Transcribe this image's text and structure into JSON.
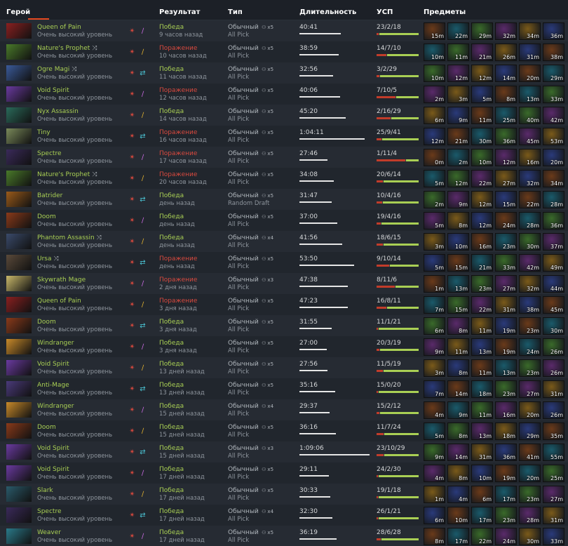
{
  "headers": {
    "hero": "Герой",
    "result": "Результат",
    "type": "Тип",
    "duration": "Длительность",
    "kda": "УСП",
    "items": "Предметы"
  },
  "rows": [
    {
      "hero": "Queen of Pain",
      "skill": "Очень высокий уровень",
      "result": "Победа",
      "win": true,
      "ago": "9 часов назад",
      "type": "Обычный",
      "party": "x5",
      "mode": "All Pick",
      "duration": "40:41",
      "kda": "23/2/18",
      "k": 23,
      "d": 2,
      "a": 18,
      "items": [
        "15m",
        "22m",
        "29m",
        "32m",
        "34m",
        "36m"
      ],
      "portrait": "#8a2020"
    },
    {
      "hero": "Nature's Prophet",
      "shuffle": true,
      "skill": "Очень высокий уровень",
      "result": "Поражение",
      "win": false,
      "ago": "10 часов назад",
      "type": "Обычный",
      "party": "x5",
      "mode": "All Pick",
      "duration": "38:59",
      "kda": "14/7/10",
      "k": 14,
      "d": 7,
      "a": 10,
      "items": [
        "10m",
        "11m",
        "21m",
        "26m",
        "31m",
        "38m"
      ],
      "portrait": "#4a7a2a"
    },
    {
      "hero": "Ogre Magi",
      "shuffle": true,
      "skill": "Очень высокий уровень",
      "result": "Победа",
      "win": true,
      "ago": "11 часов назад",
      "type": "Обычный",
      "party": "x5",
      "mode": "All Pick",
      "duration": "32:56",
      "kda": "3/2/29",
      "k": 3,
      "d": 2,
      "a": 29,
      "items": [
        "10m",
        "12m",
        "12m",
        "14m",
        "20m",
        "29m"
      ],
      "portrait": "#3a5a9a"
    },
    {
      "hero": "Void Spirit",
      "skill": "Очень высокий уровень",
      "result": "Поражение",
      "win": false,
      "ago": "12 часов назад",
      "type": "Обычный",
      "party": "x5",
      "mode": "All Pick",
      "duration": "40:06",
      "kda": "7/10/5",
      "k": 7,
      "d": 10,
      "a": 5,
      "items": [
        "2m",
        "3m",
        "5m",
        "8m",
        "13m",
        "33m"
      ],
      "portrait": "#6a3aa0"
    },
    {
      "hero": "Nyx Assassin",
      "skill": "Очень высокий уровень",
      "result": "Победа",
      "win": true,
      "ago": "14 часов назад",
      "type": "Обычный",
      "party": "x5",
      "mode": "All Pick",
      "duration": "45:20",
      "kda": "2/16/29",
      "k": 2,
      "d": 16,
      "a": 29,
      "items": [
        "6m",
        "9m",
        "11m",
        "25m",
        "40m",
        "42m"
      ],
      "portrait": "#2a6a5a"
    },
    {
      "hero": "Tiny",
      "skill": "Очень высокий уровень",
      "result": "Поражение",
      "win": false,
      "ago": "16 часов назад",
      "type": "Обычный",
      "party": "x5",
      "mode": "All Pick",
      "duration": "1:04:11",
      "kda": "25/9/41",
      "k": 25,
      "d": 9,
      "a": 41,
      "items": [
        "12m",
        "21m",
        "30m",
        "36m",
        "45m",
        "53m"
      ],
      "portrait": "#7a8a5a"
    },
    {
      "hero": "Spectre",
      "skill": "Очень высокий уровень",
      "result": "Поражение",
      "win": false,
      "ago": "17 часов назад",
      "type": "Обычный",
      "party": "x5",
      "mode": "All Pick",
      "duration": "27:46",
      "kda": "1/11/4",
      "k": 1,
      "d": 11,
      "a": 4,
      "items": [
        "0m",
        "2m",
        "10m",
        "12m",
        "16m",
        "20m"
      ],
      "portrait": "#3a2a5a"
    },
    {
      "hero": "Nature's Prophet",
      "shuffle": true,
      "skill": "Очень высокий уровень",
      "result": "Поражение",
      "win": false,
      "ago": "20 часов назад",
      "type": "Обычный",
      "party": "x5",
      "mode": "All Pick",
      "duration": "34:08",
      "kda": "20/6/14",
      "k": 20,
      "d": 6,
      "a": 14,
      "items": [
        "5m",
        "12m",
        "22m",
        "27m",
        "32m",
        "34m"
      ],
      "portrait": "#4a7a2a"
    },
    {
      "hero": "Batrider",
      "skill": "Очень высокий уровень",
      "result": "Победа",
      "win": true,
      "ago": "день назад",
      "type": "Обычный",
      "party": "x5",
      "mode": "Random Draft",
      "duration": "31:47",
      "kda": "10/4/16",
      "k": 10,
      "d": 4,
      "a": 16,
      "items": [
        "2m",
        "9m",
        "12m",
        "15m",
        "22m",
        "28m"
      ],
      "portrait": "#9a5a1a"
    },
    {
      "hero": "Doom",
      "skill": "Очень высокий уровень",
      "result": "Победа",
      "win": true,
      "ago": "день назад",
      "type": "Обычный",
      "party": "x5",
      "mode": "All Pick",
      "duration": "37:00",
      "kda": "19/4/16",
      "k": 19,
      "d": 4,
      "a": 16,
      "items": [
        "5m",
        "8m",
        "12m",
        "24m",
        "28m",
        "36m"
      ],
      "portrait": "#8a3a1a"
    },
    {
      "hero": "Phantom Assassin",
      "shuffle": true,
      "skill": "Очень высокий уровень",
      "result": "Победа",
      "win": true,
      "ago": "день назад",
      "type": "Обычный",
      "party": "x4",
      "mode": "All Pick",
      "duration": "41:56",
      "kda": "18/6/15",
      "k": 18,
      "d": 6,
      "a": 15,
      "items": [
        "3m",
        "10m",
        "16m",
        "23m",
        "30m",
        "37m"
      ],
      "portrait": "#3a4a6a"
    },
    {
      "hero": "Ursa",
      "shuffle": true,
      "skill": "Очень высокий уровень",
      "result": "Поражение",
      "win": false,
      "ago": "день назад",
      "type": "Обычный",
      "party": "x5",
      "mode": "All Pick",
      "duration": "53:50",
      "kda": "9/10/14",
      "k": 9,
      "d": 10,
      "a": 14,
      "items": [
        "5m",
        "15m",
        "21m",
        "33m",
        "42m",
        "49m"
      ],
      "portrait": "#5a4a3a"
    },
    {
      "hero": "Skywrath Mage",
      "skill": "Очень высокий уровень",
      "result": "Поражение",
      "win": false,
      "ago": "2 дня назад",
      "type": "Обычный",
      "party": "x3",
      "mode": "All Pick",
      "duration": "47:38",
      "kda": "8/11/6",
      "k": 8,
      "d": 11,
      "a": 6,
      "items": [
        "1m",
        "13m",
        "23m",
        "27m",
        "32m",
        "44m"
      ],
      "portrait": "#c8b86a"
    },
    {
      "hero": "Queen of Pain",
      "skill": "Очень высокий уровень",
      "result": "Поражение",
      "win": false,
      "ago": "3 дня назад",
      "type": "Обычный",
      "party": "x5",
      "mode": "All Pick",
      "duration": "47:23",
      "kda": "16/8/11",
      "k": 16,
      "d": 8,
      "a": 11,
      "items": [
        "7m",
        "15m",
        "22m",
        "31m",
        "38m",
        "45m"
      ],
      "portrait": "#8a2020"
    },
    {
      "hero": "Doom",
      "skill": "Очень высокий уровень",
      "result": "Победа",
      "win": true,
      "ago": "3 дня назад",
      "type": "Обычный",
      "party": "x5",
      "mode": "All Pick",
      "duration": "31:55",
      "kda": "11/1/21",
      "k": 11,
      "d": 1,
      "a": 21,
      "items": [
        "6m",
        "8m",
        "11m",
        "19m",
        "23m",
        "30m"
      ],
      "portrait": "#8a3a1a"
    },
    {
      "hero": "Windranger",
      "skill": "Очень высокий уровень",
      "result": "Победа",
      "win": true,
      "ago": "3 дня назад",
      "type": "Обычный",
      "party": "x5",
      "mode": "All Pick",
      "duration": "27:00",
      "kda": "20/3/19",
      "k": 20,
      "d": 3,
      "a": 19,
      "items": [
        "9m",
        "11m",
        "13m",
        "19m",
        "24m",
        "26m"
      ],
      "portrait": "#c88a2a"
    },
    {
      "hero": "Void Spirit",
      "skill": "Очень высокий уровень",
      "result": "Победа",
      "win": true,
      "ago": "13 дней назад",
      "type": "Обычный",
      "party": "x5",
      "mode": "All Pick",
      "duration": "27:56",
      "kda": "11/5/19",
      "k": 11,
      "d": 5,
      "a": 19,
      "items": [
        "3m",
        "8m",
        "11m",
        "13m",
        "23m",
        "26m"
      ],
      "portrait": "#6a3aa0"
    },
    {
      "hero": "Anti-Mage",
      "skill": "Очень высокий уровень",
      "result": "Победа",
      "win": true,
      "ago": "13 дней назад",
      "type": "Обычный",
      "party": "x5",
      "mode": "All Pick",
      "duration": "35:16",
      "kda": "15/0/20",
      "k": 15,
      "d": 0,
      "a": 20,
      "items": [
        "7m",
        "14m",
        "18m",
        "23m",
        "27m",
        "31m"
      ],
      "portrait": "#4a3a7a"
    },
    {
      "hero": "Windranger",
      "skill": "Очень высокий уровень",
      "result": "Победа",
      "win": true,
      "ago": "15 дней назад",
      "type": "Обычный",
      "party": "x4",
      "mode": "All Pick",
      "duration": "29:37",
      "kda": "15/2/12",
      "k": 15,
      "d": 2,
      "a": 12,
      "items": [
        "4m",
        "9m",
        "11m",
        "16m",
        "20m",
        "26m"
      ],
      "portrait": "#c88a2a"
    },
    {
      "hero": "Doom",
      "skill": "Очень высокий уровень",
      "result": "Победа",
      "win": true,
      "ago": "15 дней назад",
      "type": "Обычный",
      "party": "x5",
      "mode": "All Pick",
      "duration": "36:16",
      "kda": "11/7/24",
      "k": 11,
      "d": 7,
      "a": 24,
      "items": [
        "5m",
        "8m",
        "13m",
        "18m",
        "29m",
        "35m"
      ],
      "portrait": "#8a3a1a"
    },
    {
      "hero": "Void Spirit",
      "skill": "Очень высокий уровень",
      "result": "Победа",
      "win": true,
      "ago": "15 дней назад",
      "type": "Обычный",
      "party": "x3",
      "mode": "All Pick",
      "duration": "1:09:06",
      "kda": "23/10/29",
      "k": 23,
      "d": 10,
      "a": 29,
      "items": [
        "9m",
        "14m",
        "31m",
        "36m",
        "41m",
        "55m"
      ],
      "portrait": "#6a3aa0"
    },
    {
      "hero": "Void Spirit",
      "skill": "Очень высокий уровень",
      "result": "Победа",
      "win": true,
      "ago": "17 дней назад",
      "type": "Обычный",
      "party": "x5",
      "mode": "All Pick",
      "duration": "29:11",
      "kda": "24/2/30",
      "k": 24,
      "d": 2,
      "a": 30,
      "items": [
        "4m",
        "8m",
        "10m",
        "19m",
        "20m",
        "25m"
      ],
      "portrait": "#6a3aa0"
    },
    {
      "hero": "Slark",
      "skill": "Очень высокий уровень",
      "result": "Победа",
      "win": true,
      "ago": "17 дней назад",
      "type": "Обычный",
      "party": "x5",
      "mode": "All Pick",
      "duration": "30:33",
      "kda": "19/1/18",
      "k": 19,
      "d": 1,
      "a": 18,
      "items": [
        "1m",
        "4m",
        "6m",
        "17m",
        "23m",
        "27m"
      ],
      "portrait": "#2a5a6a"
    },
    {
      "hero": "Spectre",
      "skill": "Очень высокий уровень",
      "result": "Победа",
      "win": true,
      "ago": "17 дней назад",
      "type": "Обычный",
      "party": "x4",
      "mode": "All Pick",
      "duration": "32:30",
      "kda": "26/1/21",
      "k": 26,
      "d": 1,
      "a": 21,
      "items": [
        "6m",
        "10m",
        "17m",
        "23m",
        "28m",
        "31m"
      ],
      "portrait": "#3a2a5a"
    },
    {
      "hero": "Weaver",
      "skill": "Очень высокий уровень",
      "result": "Победа",
      "win": true,
      "ago": "17 дней назад",
      "type": "Обычный",
      "party": "x5",
      "mode": "All Pick",
      "duration": "36:19",
      "kda": "28/6/28",
      "k": 28,
      "d": 6,
      "a": 28,
      "items": [
        "8m",
        "17m",
        "22m",
        "24m",
        "30m",
        "33m"
      ],
      "portrait": "#2a7a8a"
    }
  ],
  "itemColors": [
    "#6a3a1a",
    "#1a5a6a",
    "#3a6a2a",
    "#5a2a6a",
    "#7a5a1a",
    "#2a3a7a"
  ],
  "colors": {
    "win": "#a9cf54",
    "loss": "#d8493e",
    "accent": "#e6491f",
    "bg": "#1c2027",
    "rowEven": "#262b33",
    "rowOdd": "#21262d"
  }
}
